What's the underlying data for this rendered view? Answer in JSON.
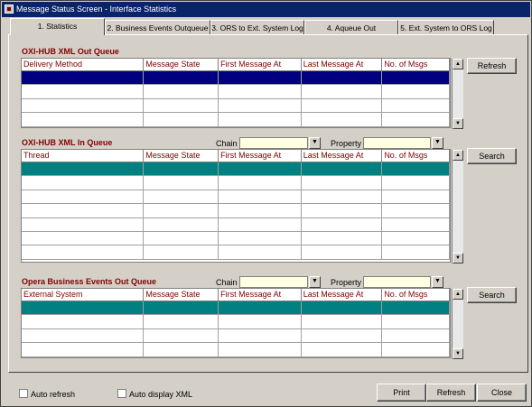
{
  "window": {
    "title": "Message Status Screen - Interface Statistics"
  },
  "tabs": [
    {
      "label": "1. Statistics"
    },
    {
      "label": "2. Business Events Outqueue"
    },
    {
      "label": "3. ORS to Ext. System Log"
    },
    {
      "label": "4. Aqueue Out"
    },
    {
      "label": "5. Ext. System to ORS Log"
    }
  ],
  "out_queue": {
    "title": "OXI-HUB XML Out Queue",
    "columns": [
      "Delivery Method",
      "Message State",
      "First Message At",
      "Last Message At",
      "No. of Msgs"
    ],
    "refresh_label": "Refresh"
  },
  "in_queue": {
    "title": "OXI-HUB XML In Queue",
    "chain_label": "Chain",
    "property_label": "Property",
    "columns": [
      "Thread",
      "Message State",
      "First Message At",
      "Last Message At",
      "No. of Msgs"
    ],
    "search_label": "Search"
  },
  "business_queue": {
    "title": "Opera Business Events Out Queue",
    "chain_label": "Chain",
    "property_label": "Property",
    "columns": [
      "External System",
      "Message State",
      "First Message At",
      "Last Message At",
      "No. of Msgs"
    ],
    "search_label": "Search"
  },
  "footer": {
    "auto_refresh_label": "Auto refresh",
    "auto_display_xml_label": "Auto display XML",
    "print_label": "Print",
    "refresh_label": "Refresh",
    "close_label": "Close"
  },
  "colors": {
    "selected_blue": "#000080",
    "selected_teal": "#008080",
    "header_text": "#800000",
    "combo_bg": "#ffffe1"
  },
  "icons": {
    "scroll_up": "up-arrow-icon",
    "scroll_down": "down-arrow-icon",
    "dropdown": "dropdown-arrow-icon"
  }
}
